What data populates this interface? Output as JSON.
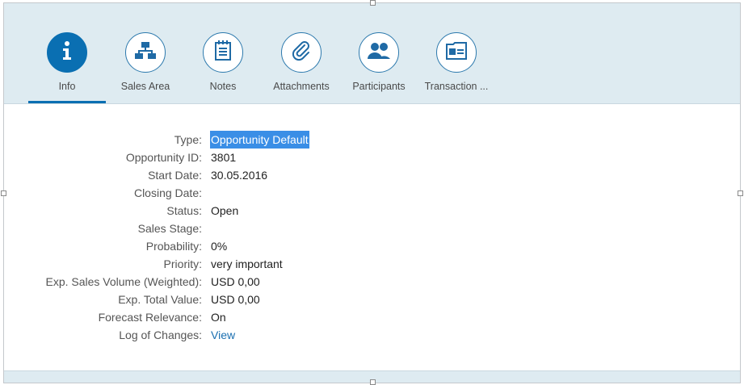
{
  "tabs": [
    {
      "label": "Info",
      "icon": "info-icon",
      "active": true
    },
    {
      "label": "Sales Area",
      "icon": "org-chart-icon",
      "active": false
    },
    {
      "label": "Notes",
      "icon": "notes-icon",
      "active": false
    },
    {
      "label": "Attachments",
      "icon": "paperclip-icon",
      "active": false
    },
    {
      "label": "Participants",
      "icon": "people-icon",
      "active": false
    },
    {
      "label": "Transaction ...",
      "icon": "id-card-icon",
      "active": false
    }
  ],
  "fields": [
    {
      "label": "Type:",
      "value": "Opportunity Default"
    },
    {
      "label": "Opportunity ID:",
      "value": "3801"
    },
    {
      "label": "Start Date:",
      "value": "30.05.2016"
    },
    {
      "label": "Closing Date:",
      "value": ""
    },
    {
      "label": "Status:",
      "value": "Open"
    },
    {
      "label": "Sales Stage:",
      "value": ""
    },
    {
      "label": "Probability:",
      "value": "0%"
    },
    {
      "label": "Priority:",
      "value": "very important"
    },
    {
      "label": "Exp. Sales Volume (Weighted):",
      "value": "USD 0,00"
    },
    {
      "label": "Exp. Total Value:",
      "value": "USD 0,00"
    },
    {
      "label": "Forecast Relevance:",
      "value": "On"
    },
    {
      "label": "Log of Changes:",
      "value": "View"
    }
  ],
  "colors": {
    "accent": "#0a6fb2",
    "header_bg": "#deebf1",
    "selection": "#3a8ee6",
    "link": "#1a6fb0"
  }
}
